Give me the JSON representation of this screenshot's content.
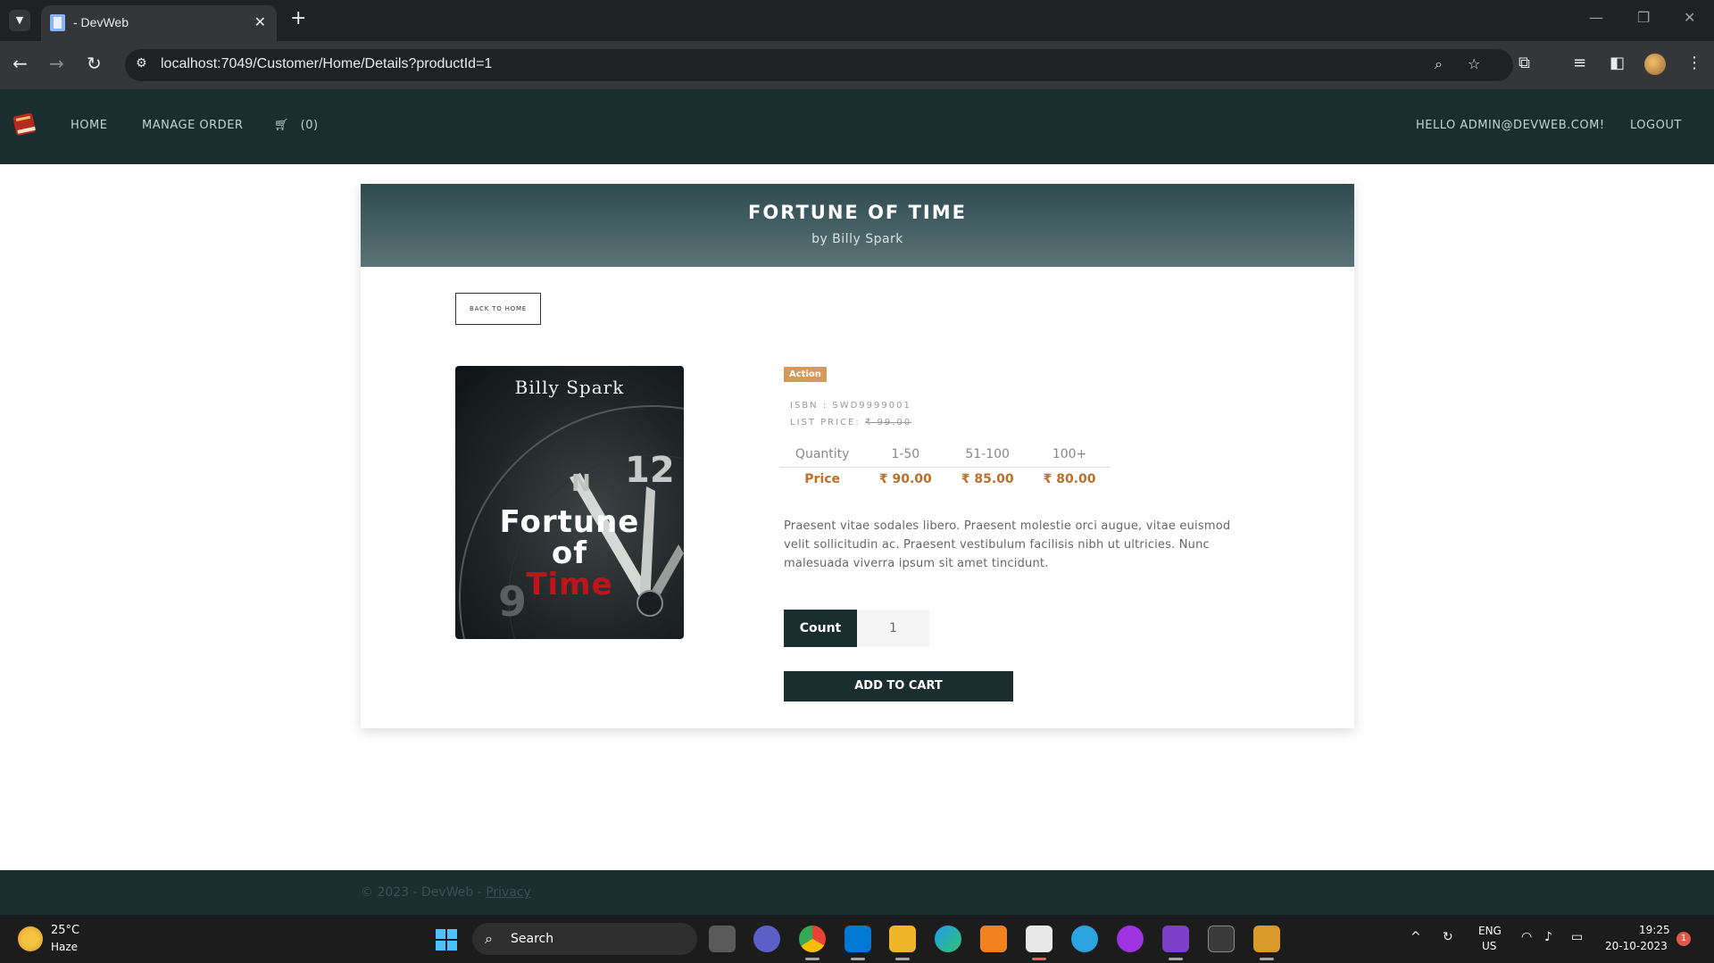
{
  "browser": {
    "tab_title": "- DevWeb",
    "url": "localhost:7049/Customer/Home/Details?productId=1"
  },
  "nav": {
    "home": "HOME",
    "manage_order": "MANAGE ORDER",
    "cart_count": "(0)",
    "greeting": "HELLO ADMIN@DEVWEB.COM!",
    "logout": "LOGOUT"
  },
  "product": {
    "title": "FORTUNE OF TIME",
    "author": "by Billy Spark",
    "back_label": "BACK TO HOME",
    "cover": {
      "author": "Billy Spark",
      "line1": "Fortune",
      "line2": "of",
      "line3": "Time",
      "accent_color": "#c0141a"
    },
    "category": "Action",
    "isbn": "ISBN : SWD9999001",
    "list_price_label": "LIST PRICE: ",
    "list_price_value": "₹ 99.00",
    "price_table": {
      "header": [
        "Quantity",
        "1-50",
        "51-100",
        "100+"
      ],
      "row": [
        "Price",
        "₹ 90.00",
        "₹ 85.00",
        "₹ 80.00"
      ]
    },
    "description": "Praesent vitae sodales libero. Praesent molestie orci augue, vitae euismod velit sollicitudin ac. Praesent vestibulum facilisis nibh ut ultricies. Nunc malesuada viverra ipsum sit amet tincidunt.",
    "count_label": "Count",
    "count_value": "1",
    "add_to_cart": "ADD TO CART"
  },
  "footer": {
    "text": "© 2023 - DevWeb - ",
    "privacy": "Privacy"
  },
  "taskbar": {
    "temp": "25°C",
    "weather": "Haze",
    "search": "Search",
    "lang1": "ENG",
    "lang2": "US",
    "time": "19:25",
    "date": "20-10-2023",
    "notifications": "1"
  },
  "colors": {
    "navbar": "#1a2e30",
    "accent_price": "#b8702a",
    "category_badge": "#d39a5a"
  }
}
